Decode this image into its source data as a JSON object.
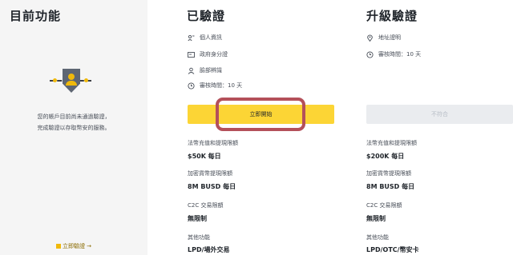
{
  "left": {
    "title": "目前功能",
    "desc_line1": "您的帳戶目前尚未通過驗證，",
    "desc_line2": "完成驗證以存取幣安的服務。",
    "upgrade_link": "立即驗證 →"
  },
  "verified": {
    "title": "已驗證",
    "features": [
      {
        "icon": "id-badge-icon",
        "text": "個人資訊"
      },
      {
        "icon": "id-card-icon",
        "text": "政府身分證"
      },
      {
        "icon": "face-icon",
        "text": "臉部辨識"
      },
      {
        "icon": "clock-icon",
        "text": "審核時間：10 天"
      }
    ],
    "button_label": "立即開始",
    "limits": [
      {
        "label": "法幣充值和提現限額",
        "value": "$50K 每日"
      },
      {
        "label": "加密貨幣提現限額",
        "value": "8M BUSD 每日"
      },
      {
        "label": "C2C 交易限額",
        "value": "無限制"
      },
      {
        "label": "其他功能",
        "value": "LPD/場外交易"
      }
    ]
  },
  "upgrade": {
    "title": "升級驗證",
    "features": [
      {
        "icon": "location-icon",
        "text": "地址證明"
      },
      {
        "icon": "clock-icon",
        "text": "審核時間：10 天"
      }
    ],
    "button_label": "不符合",
    "limits": [
      {
        "label": "法幣充值和提現限額",
        "value": "$200K 每日"
      },
      {
        "label": "加密貨幣提現限額",
        "value": "8M BUSD 每日"
      },
      {
        "label": "C2C 交易限額",
        "value": "無限制"
      },
      {
        "label": "其他功能",
        "value": "LPD/OTC/幣安卡"
      }
    ]
  },
  "colors": {
    "accent": "#fcd535",
    "highlight_ring": "#b4505a",
    "sidebar_bg": "#f5f5f5"
  }
}
